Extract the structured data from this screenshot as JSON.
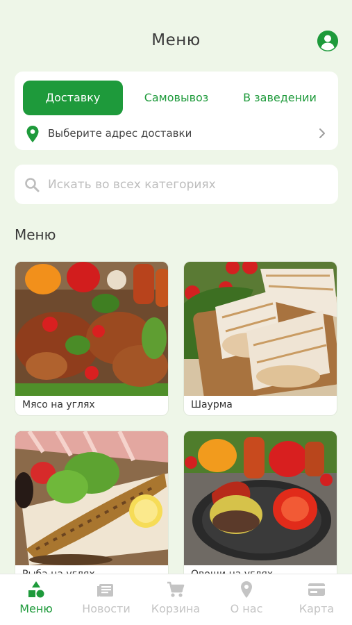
{
  "header": {
    "title": "Меню"
  },
  "delivery": {
    "tabs": [
      {
        "label": "Доставку",
        "active": true
      },
      {
        "label": "Самовывоз",
        "active": false
      },
      {
        "label": "В заведении",
        "active": false
      }
    ],
    "address_placeholder": "Выберите адрес доставки"
  },
  "search": {
    "placeholder": "Искать во всех категориях",
    "value": ""
  },
  "section": {
    "title": "Меню"
  },
  "categories": [
    {
      "label": "Мясо на углях"
    },
    {
      "label": "Шаурма"
    },
    {
      "label": "Рыба на углях"
    },
    {
      "label": "Овощи на углях"
    }
  ],
  "bottom_nav": [
    {
      "label": "Меню",
      "icon": "shapes-icon",
      "active": true
    },
    {
      "label": "Новости",
      "icon": "news-icon",
      "active": false
    },
    {
      "label": "Корзина",
      "icon": "cart-icon",
      "active": false
    },
    {
      "label": "О нас",
      "icon": "location-pin-icon",
      "active": false
    },
    {
      "label": "Карта",
      "icon": "credit-card-icon",
      "active": false
    }
  ],
  "colors": {
    "accent": "#1e9a3b",
    "background": "#eef6e8",
    "inactive_nav": "#c4c4c4",
    "placeholder": "#bdbdbd"
  }
}
